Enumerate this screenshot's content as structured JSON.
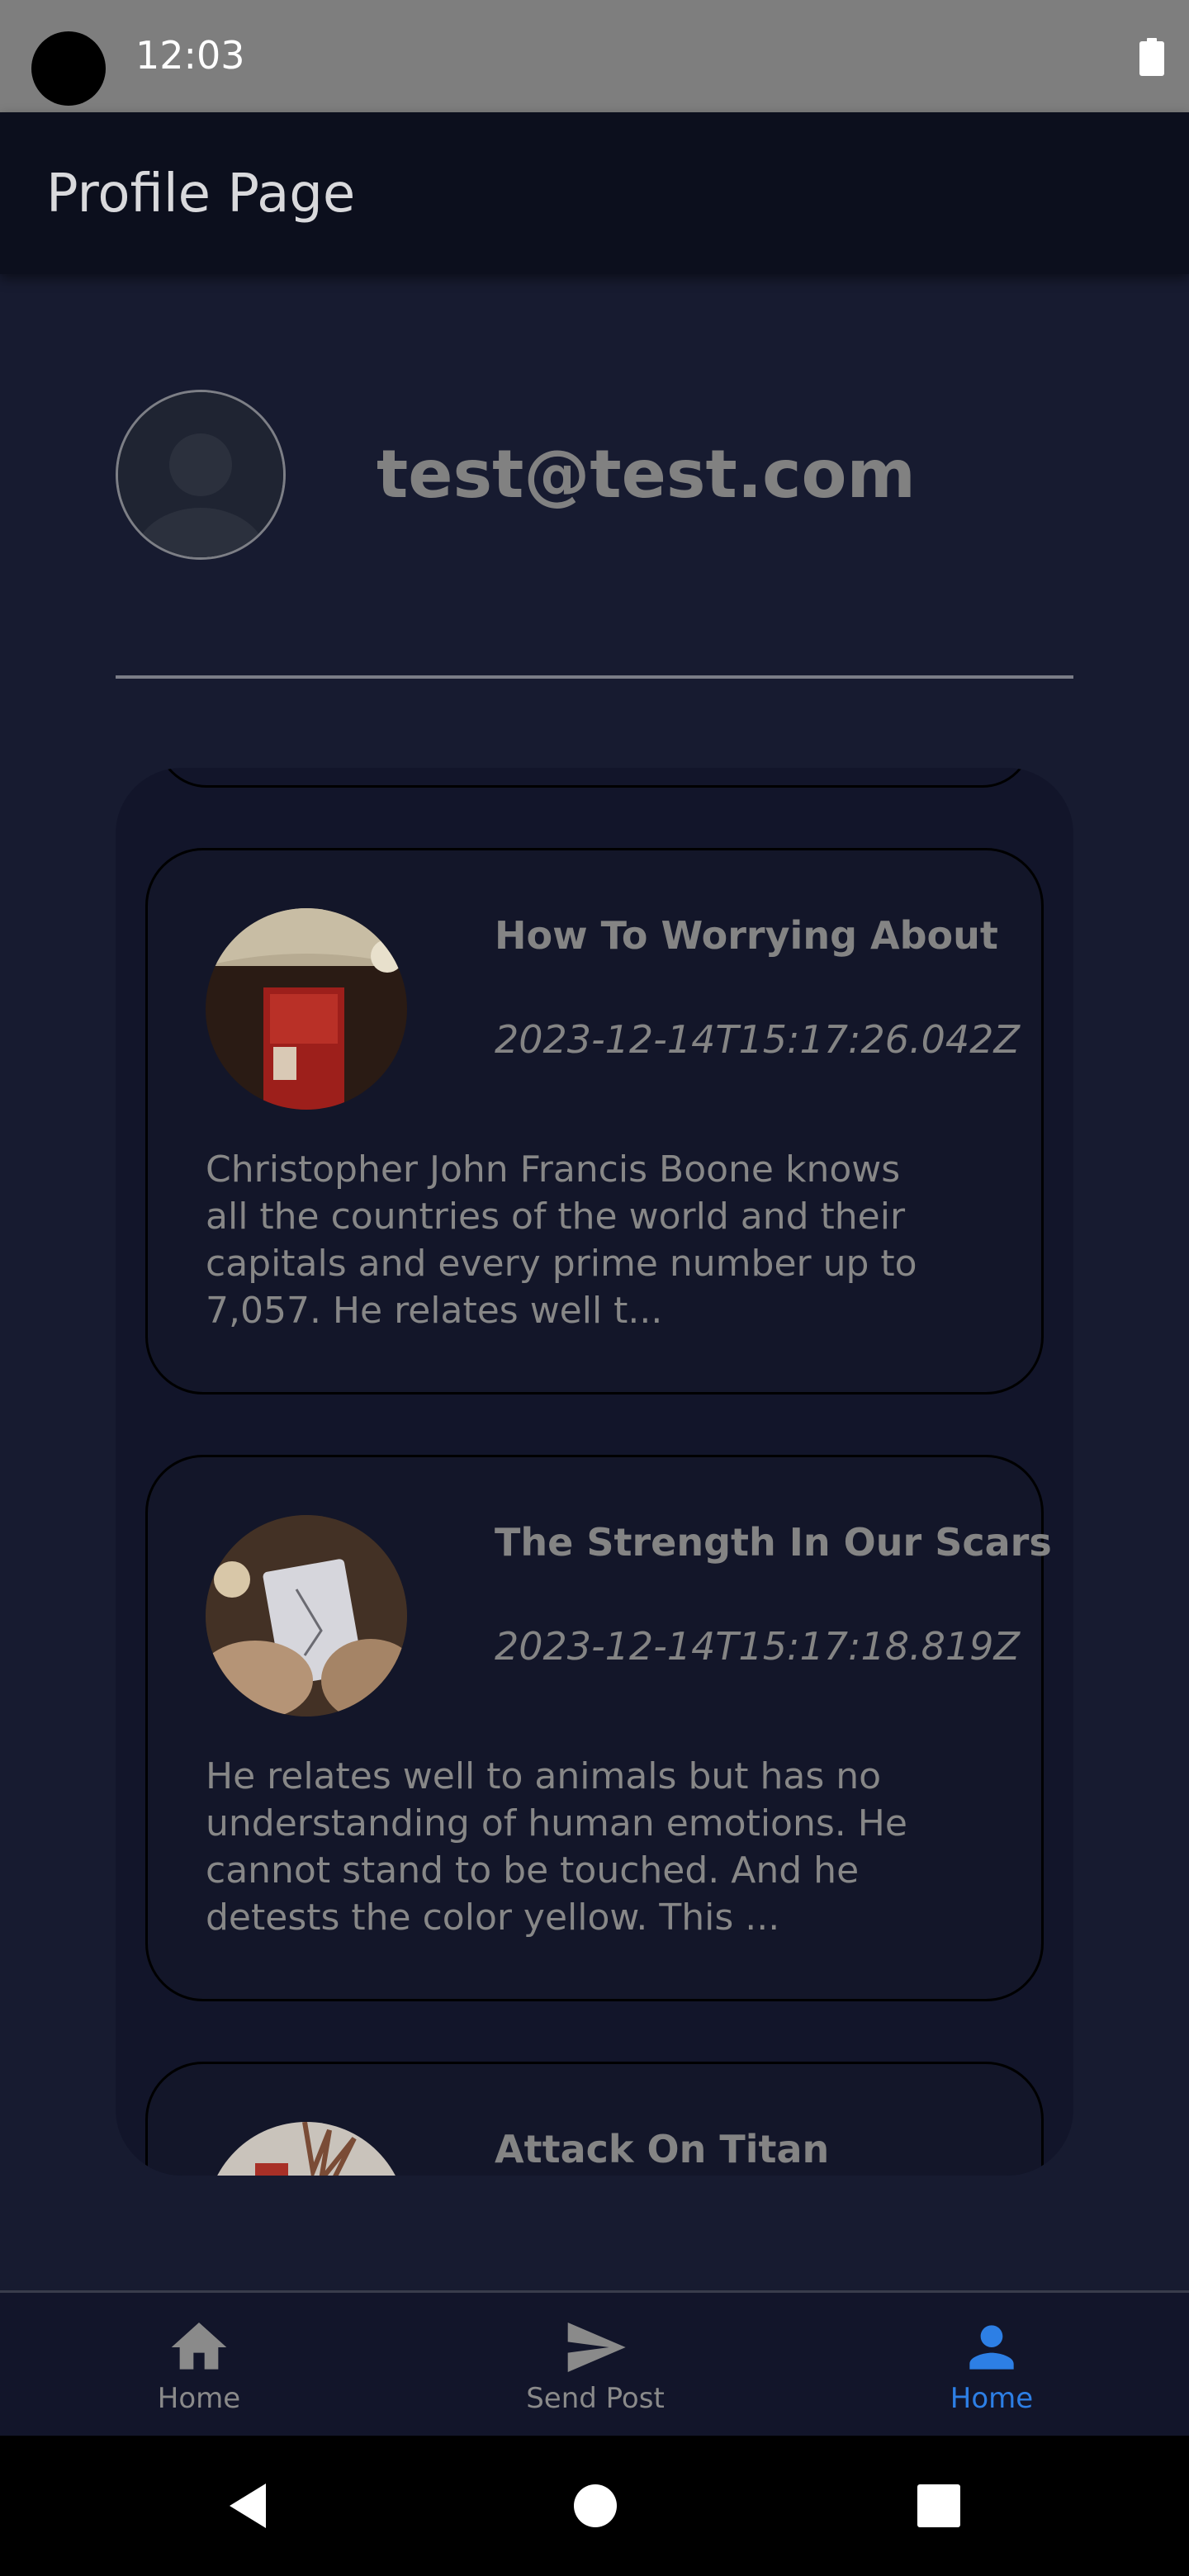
{
  "status_bar": {
    "time": "12:03"
  },
  "app_bar": {
    "title": "Profile Page"
  },
  "profile": {
    "email": "test@test.com"
  },
  "posts": [
    {
      "title": "How To Worrying About",
      "date": "2023-12-14T15:17:26.042Z",
      "excerpt": "Christopher John Francis Boone knows all the countries of the world and their capitals and every prime number up to 7,057. He relates well t..."
    },
    {
      "title": "The Strength In Our Scars",
      "date": "2023-12-14T15:17:18.819Z",
      "excerpt": "He relates well to animals but has no understanding of human emotions. He cannot stand to be touched. And he detests the color yellow. This ..."
    },
    {
      "title": "Attack On Titan",
      "date": "",
      "excerpt": ""
    }
  ],
  "bottom_nav": {
    "items": [
      {
        "label": "Home",
        "icon": "home-icon"
      },
      {
        "label": "Send Post",
        "icon": "send-icon"
      },
      {
        "label": "Home",
        "icon": "person-icon",
        "active": true
      }
    ]
  },
  "colors": {
    "background": "#171b30",
    "app_bar": "#0c0f1d",
    "accent": "#2d7fe5",
    "text_muted": "#848484"
  }
}
